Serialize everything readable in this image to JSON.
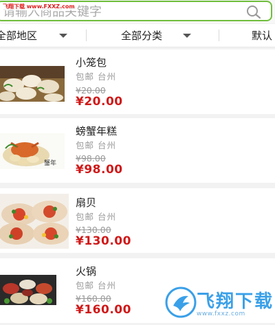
{
  "search": {
    "placeholder": "请输入商品关键字"
  },
  "watermark": {
    "top_text": "飞翔下载 www.FXXZ.com"
  },
  "filters": [
    {
      "label": "全部地区"
    },
    {
      "label": "全部分类"
    },
    {
      "label": "默认"
    }
  ],
  "products": [
    {
      "name": "小笼包",
      "shipping": "包邮",
      "region": "台州",
      "old_price": "¥20.00",
      "price": "¥20.00"
    },
    {
      "name": "螃蟹年糕",
      "shipping": "包邮",
      "region": "台州",
      "old_price": "¥98.00",
      "price": "¥98.00"
    },
    {
      "name": "扇贝",
      "shipping": "包邮",
      "region": "台州",
      "old_price": "¥130.00",
      "price": "¥130.00"
    },
    {
      "name": "火锅",
      "shipping": "包邮",
      "region": "台州",
      "old_price": "¥160.00",
      "price": "¥160.00"
    }
  ],
  "logo": {
    "text": "飞翔下载",
    "url": "www.fxxz.com"
  },
  "colors": {
    "accent": "#6fbe3c",
    "price": "#d01818",
    "logo": "#3aa0e8"
  }
}
